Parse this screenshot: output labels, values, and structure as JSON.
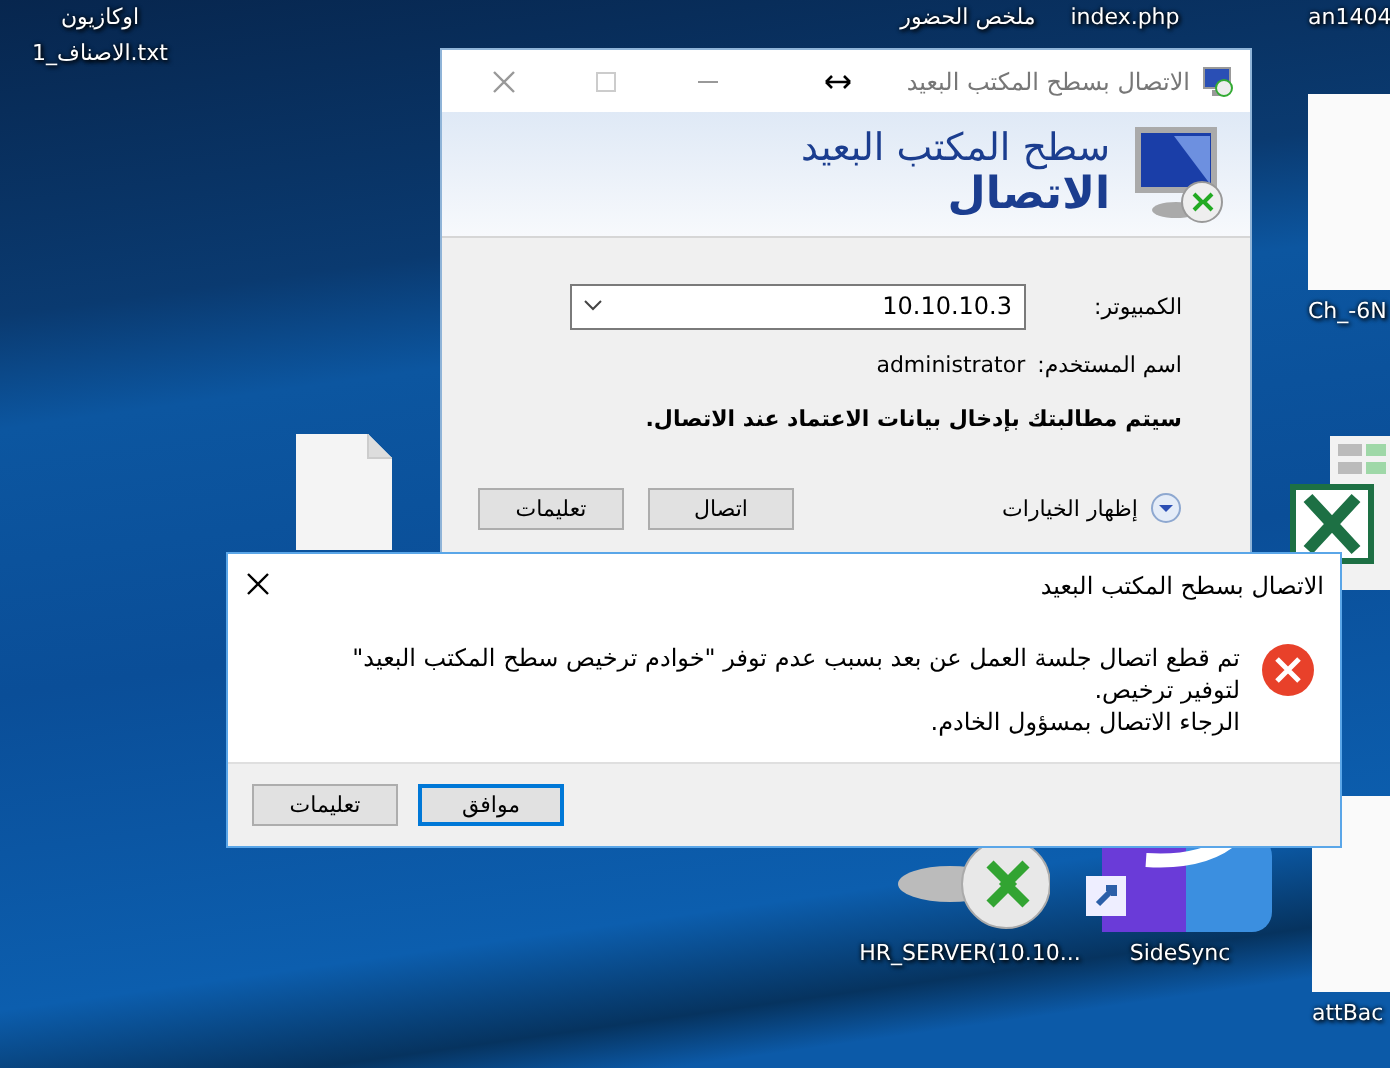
{
  "desktop_icons": [
    {
      "kind": "none",
      "lines": [
        "an1404"
      ]
    },
    {
      "kind": "none",
      "lines": [
        "index.php"
      ]
    },
    {
      "kind": "none",
      "lines": [
        "ملخص الحضور"
      ]
    },
    {
      "kind": "none",
      "lines": [
        "اوكازيون",
        "الاصناف_1.txt"
      ]
    },
    {
      "kind": "image",
      "lines": [
        "Ch_-6N"
      ]
    },
    {
      "kind": "spreadsheet"
    },
    {
      "kind": "document"
    },
    {
      "kind": "image",
      "lines": [
        "attBac"
      ]
    },
    {
      "kind": "sidesync",
      "lines": [
        "SideSync"
      ]
    },
    {
      "kind": "remote",
      "lines": [
        "HR_SERVER(10.10..."
      ]
    }
  ],
  "rdp_window": {
    "title": "الاتصال بسطح المكتب البعيد",
    "header": {
      "subtitle": "سطح المكتب البعيد",
      "title": "الاتصال"
    },
    "computer": {
      "label": "الكمبيوتر:",
      "value": "10.10.10.3"
    },
    "username": {
      "label": "اسم المستخدم:",
      "value": "administrator"
    },
    "note": "سيتم مطالبتك بإدخال بيانات الاعتماد عند الاتصال.",
    "options": {
      "label": "إظهار الخيارات",
      "expanded": false
    },
    "buttons": [
      "اتصال",
      "تعليمات"
    ]
  },
  "error_dialog": {
    "title": "الاتصال بسطح المكتب البعيد",
    "message": [
      "تم قطع اتصال جلسة العمل عن بعد بسبب عدم توفر \"خوادم ترخيص سطح المكتب البعيد\" لتوفير ترخيص.",
      "الرجاء الاتصال بمسؤول الخادم."
    ],
    "buttons": [
      {
        "label": "موافق",
        "selected": true
      },
      {
        "label": "تعليمات",
        "selected": false
      }
    ]
  }
}
